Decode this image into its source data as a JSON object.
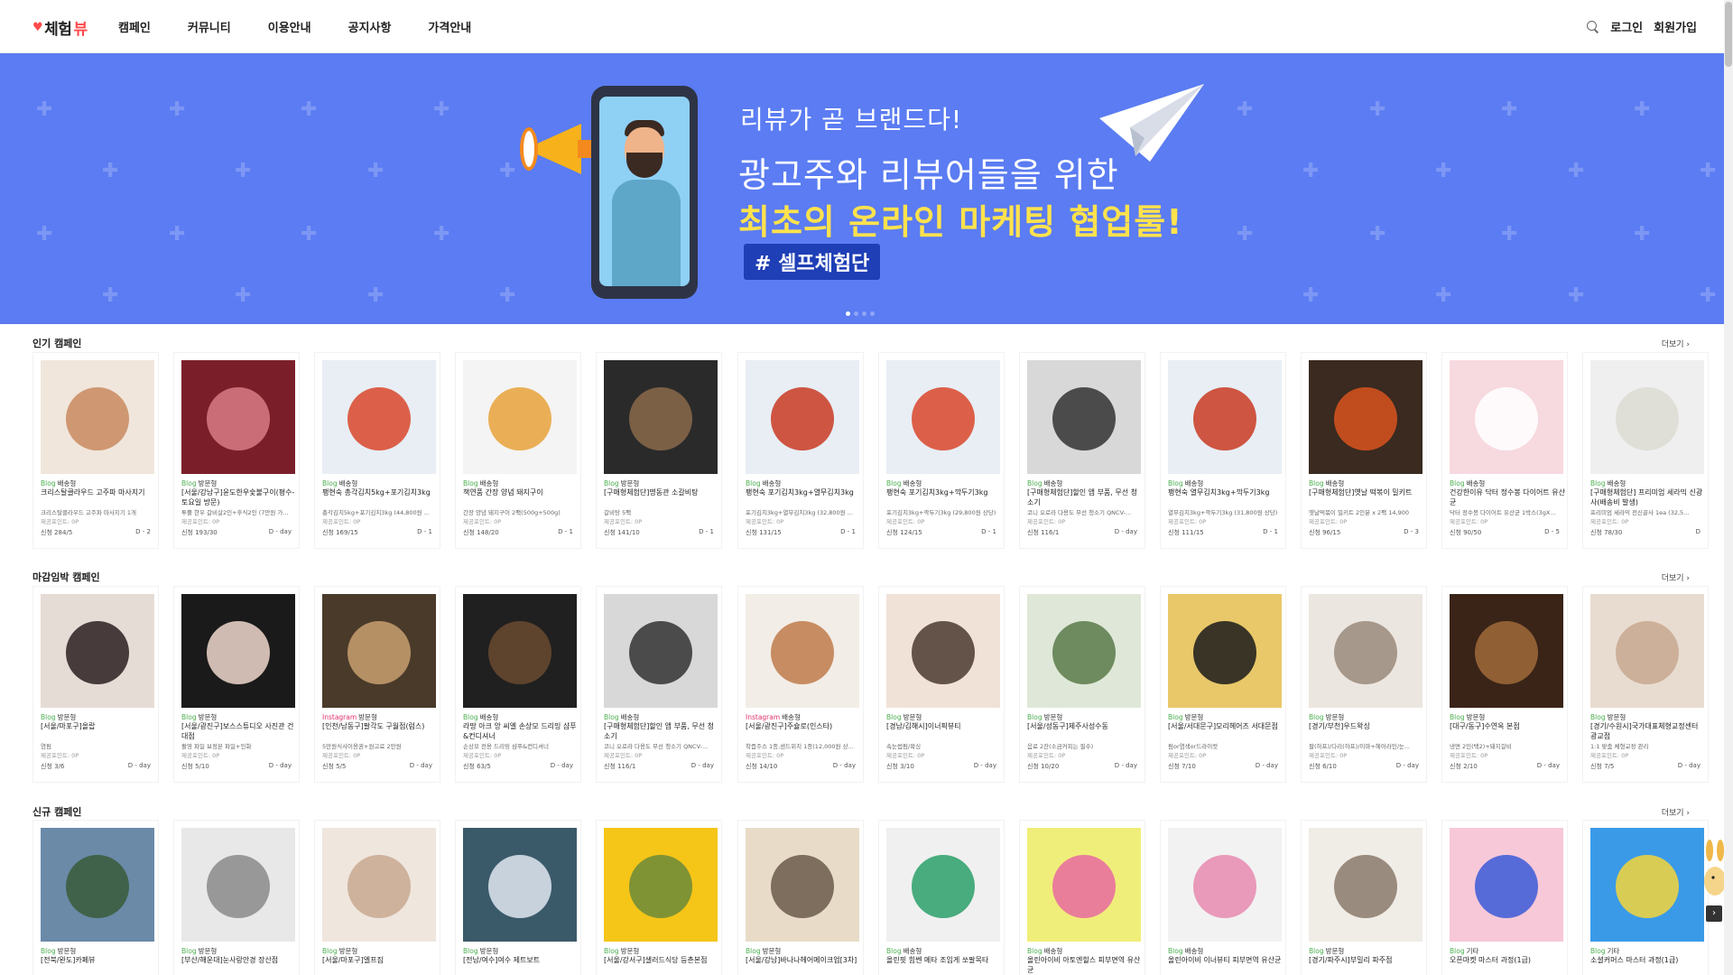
{
  "header": {
    "logo_text": "체험",
    "logo_accent": "뷰",
    "nav": [
      "캠페인",
      "커뮤니티",
      "이용안내",
      "공지사항",
      "가격안내"
    ],
    "login": "로그인",
    "signup": "회원가입"
  },
  "banner": {
    "line1": "리뷰가 곧 브랜드다!",
    "line2": "광고주와 리뷰어들을 위한",
    "line3": "최초의 온라인 마케팅 협업툴!",
    "tag": "# 셀프체험단"
  },
  "sections": [
    {
      "title": "인기 캠페인",
      "more": "더보기 ›",
      "cards": [
        {
          "platform": "Blog",
          "type": "배송형",
          "title": "크리스탈클라우드 고주파 마사지기",
          "desc": "크리스탈클라우드 고주파 마사지기 1개",
          "point": "제공포인트: 0P",
          "apply": "신청 284/5",
          "dday": "D - 2",
          "color": "#f0e6dc",
          "accent": "#c98a5f"
        },
        {
          "platform": "Blog",
          "type": "방문형",
          "title": "[서울/강남구]윤도한우숯불구이(평수-토요일 방문)",
          "desc": "투뿔 한우 갈비살2인+후식2인 (7만원 가...",
          "point": "제공포인트: 0P",
          "apply": "신청 193/30",
          "dday": "D - day",
          "color": "#7a1f2a",
          "accent": "#d97b84"
        },
        {
          "platform": "Blog",
          "type": "배송형",
          "title": "팽현숙 총각김치5kg+포기김치3kg",
          "desc": "총각김치5kg+포기김치3kg (44,800원 ...",
          "point": "제공포인트: 0P",
          "apply": "신청 169/15",
          "dday": "D - 1",
          "color": "#e8eef4",
          "accent": "#d9462a"
        },
        {
          "platform": "Blog",
          "type": "배송형",
          "title": "책연품 간장 양념 돼지구이",
          "desc": "간장 양념 돼지구이 2팩(500g+500g)",
          "point": "제공포인트: 0P",
          "apply": "신청 148/20",
          "dday": "D - 1",
          "color": "#f4f4f4",
          "accent": "#e8a23a"
        },
        {
          "platform": "Blog",
          "type": "방문형",
          "title": "[구매형체험단]명동관 소갈비탕",
          "desc": "갈비탕 5팩",
          "point": "제공포인트: 0P",
          "apply": "신청 141/10",
          "dday": "D - 1",
          "color": "#2a2a2a",
          "accent": "#8a6a4a"
        },
        {
          "platform": "Blog",
          "type": "배송형",
          "title": "팽현숙 포기김치3kg+열무김치3kg",
          "desc": "포기김치3kg+열무김치3kg (32,800원 ...",
          "point": "제공포인트: 0P",
          "apply": "신청 131/15",
          "dday": "D - 1",
          "color": "#e8eef4",
          "accent": "#c93a22"
        },
        {
          "platform": "Blog",
          "type": "배송형",
          "title": "팽현숙 포기김치3kg+깍두기3kg",
          "desc": "포기김치3kg+깍두기3kg (29,800원 상당)",
          "point": "제공포인트: 0P",
          "apply": "신청 124/15",
          "dday": "D - 1",
          "color": "#e8eef4",
          "accent": "#d9462a"
        },
        {
          "platform": "Blog",
          "type": "배송형",
          "title": "[구매형체험단]할인 앱 부품, 무선 청소기",
          "desc": "코니 오로라 다용도 무선 청소기 QNCV-...",
          "point": "제공포인트: 0P",
          "apply": "신청 116/1",
          "dday": "D - day",
          "color": "#d8d8d8",
          "accent": "#333333"
        },
        {
          "platform": "Blog",
          "type": "배송형",
          "title": "팽현숙 열무김치3kg+깍두기3kg",
          "desc": "열무김치3kg+깍두기3kg (31,800원 상당)",
          "point": "제공포인트: 0P",
          "apply": "신청 111/15",
          "dday": "D - 1",
          "color": "#e8eef4",
          "accent": "#c93a22"
        },
        {
          "platform": "Blog",
          "type": "배송형",
          "title": "[구매형체험단]옛날 떡볶이 밀키트",
          "desc": "옛날떡볶이 밀키트 2인분 x 2팩 14,900",
          "point": "제공포인트: 0P",
          "apply": "신청 96/15",
          "dday": "D - 3",
          "color": "#3a2a20",
          "accent": "#d9531e"
        },
        {
          "platform": "Blog",
          "type": "배송형",
          "title": "건강한이유 닥터 정수봉 다이어트 유산균",
          "desc": "닥터 정수봉 다이어트 유산균 1박스(3gX...",
          "point": "제공포인트: 0P",
          "apply": "신청 90/50",
          "dday": "D - 5",
          "color": "#f7d9e0",
          "accent": "#ffffff"
        },
        {
          "platform": "Blog",
          "type": "배송형",
          "title": "[구매형체험단] 프리미엄 세라믹 신광사(배송비 발생)",
          "desc": "프리미엄 세라믹 전신골사 1ea (32,5...",
          "point": "제공포인트: 0P",
          "apply": "신청 78/30",
          "dday": "D",
          "color": "#efefef",
          "accent": "#dcdcd2"
        }
      ]
    },
    {
      "title": "마감임박 캠페인",
      "more": "더보기 ›",
      "cards": [
        {
          "platform": "Blog",
          "type": "방문형",
          "title": "[서울/마포구]올랍",
          "desc": "염펌",
          "point": "제공포인트: 0P",
          "apply": "신청 3/6",
          "dday": "D - day",
          "color": "#e6dcd6",
          "accent": "#2a2020"
        },
        {
          "platform": "Blog",
          "type": "방문형",
          "title": "[서울/광진구]보스스튜디오 사진관 건대점",
          "desc": "촬영 파일 보정본 파일+인화",
          "point": "제공포인트: 0P",
          "apply": "신청 5/10",
          "dday": "D - day",
          "color": "#1a1a1a",
          "accent": "#f0d8cc"
        },
        {
          "platform": "Instagram",
          "type": "방문형",
          "title": "[인천/남동구]팔각도 구월점(럼스)",
          "desc": "5만원식사이용권+원고료 2만원",
          "point": "제공포인트: 0P",
          "apply": "신청 5/5",
          "dday": "D - day",
          "color": "#4a3a2a",
          "accent": "#c8a070"
        },
        {
          "platform": "Blog",
          "type": "배송형",
          "title": "라땅 아크 앙 씨엘 손상모 드리밍 샴푸&컨디셔너",
          "desc": "손상모 전용 드리밍 샴푸&컨디셔너",
          "point": "제공포인트: 0P",
          "apply": "신청 63/5",
          "dday": "D - day",
          "color": "#202020",
          "accent": "#6a4a30"
        },
        {
          "platform": "Blog",
          "type": "배송형",
          "title": "[구매형체험단]할인 앱 부품, 무선 청소기",
          "desc": "코니 오로라 다용도 무선 청소기 QNCV-...",
          "point": "제공포인트: 0P",
          "apply": "신청 116/1",
          "dday": "D - day",
          "color": "#d8d8d8",
          "accent": "#333333"
        },
        {
          "platform": "Instagram",
          "type": "배송형",
          "title": "[서울/광진구]주슐로(인스타)",
          "desc": "착즙주스 1종,샌드위치 1종(12,000원 상...",
          "point": "제공포인트: 0P",
          "apply": "신청 14/10",
          "dday": "D - day",
          "color": "#f2ede6",
          "accent": "#c07a4a"
        },
        {
          "platform": "Blog",
          "type": "방문형",
          "title": "[경남/김해시]이너픽뷰티",
          "desc": "속눈썹펌/왁싱",
          "point": "제공포인트: 0P",
          "apply": "신청 3/10",
          "dday": "D - day",
          "color": "#f1e2d8",
          "accent": "#4a3a30"
        },
        {
          "platform": "Blog",
          "type": "방문형",
          "title": "[서울/성동구]제주사성수동",
          "desc": "음료 2잔(소금커피는 필수)",
          "point": "제공포인트: 0P",
          "apply": "신청 10/20",
          "dday": "D - day",
          "color": "#dfe8d8",
          "accent": "#5a7a4a"
        },
        {
          "platform": "Blog",
          "type": "방문형",
          "title": "[서울/서대문구]모리헤어즈 서대문점",
          "desc": "펌or염색or드라이컷",
          "point": "제공포인트: 0P",
          "apply": "신청 7/10",
          "dday": "D - day",
          "color": "#e9c86a",
          "accent": "#1a1a1a"
        },
        {
          "platform": "Blog",
          "type": "방문형",
          "title": "[경기/부천]우드왁싱",
          "desc": "팔(하프)/다리(하프)/이마+헤어라인/눈...",
          "point": "제공포인트: 0P",
          "apply": "신청 6/10",
          "dday": "D - day",
          "color": "#ece6e0",
          "accent": "#9a8a7a"
        },
        {
          "platform": "Blog",
          "type": "방문형",
          "title": "[대구/동구]수연옥 본점",
          "desc": "냉면 2인(택2)+돼지갈비",
          "point": "제공포인트: 0P",
          "apply": "신청 2/10",
          "dday": "D - day",
          "color": "#3a2418",
          "accent": "#a06a3a"
        },
        {
          "platform": "Blog",
          "type": "방문형",
          "title": "[경기/수원시]국가대표체형교정센터 광교점",
          "desc": "1:1 맞춤 체형교정 관리",
          "point": "제공포인트: 0P",
          "apply": "신청 7/5",
          "dday": "D - day",
          "color": "#e8dcd0",
          "accent": "#c8a890"
        }
      ]
    },
    {
      "title": "신규 캠페인",
      "more": "더보기 ›",
      "cards": [
        {
          "platform": "Blog",
          "type": "방문형",
          "title": "[전북/완도]카페뷰",
          "color": "#6a8aa8",
          "accent": "#3a5a3a"
        },
        {
          "platform": "Blog",
          "type": "방문형",
          "title": "[부산/해운대]눈사랑안경 장산점",
          "color": "#e8e8e8",
          "accent": "#8a8a8a"
        },
        {
          "platform": "Blog",
          "type": "방문형",
          "title": "[서울/마포구]엘프짐",
          "color": "#efe6de",
          "accent": "#c8a890"
        },
        {
          "platform": "Blog",
          "type": "방문형",
          "title": "[전남/여수]여수 제트보트",
          "color": "#3a5a6a",
          "accent": "#e0e8f0"
        },
        {
          "platform": "Blog",
          "type": "방문형",
          "title": "[서울/강서구]샐러드식당 등촌본점",
          "color": "#f5c518",
          "accent": "#6a8a3a"
        },
        {
          "platform": "Blog",
          "type": "방문형",
          "title": "[서울/강남]바나나헤어메이크업[3차]",
          "color": "#e8dcc8",
          "accent": "#6a5a4a"
        },
        {
          "platform": "Blog",
          "type": "배송형",
          "title": "올린핏 힘쎈 메타 조임게 쏘팔목타",
          "color": "#f0f0f0",
          "accent": "#2aa06a"
        },
        {
          "platform": "Blog",
          "type": "배송형",
          "title": "올린아이비 아토엔힐스 피부면역 유산균",
          "color": "#f0ee7a",
          "accent": "#e86aa0"
        },
        {
          "platform": "Blog",
          "type": "배송형",
          "title": "올린아이비 이너뷰티 피부면역 유산균",
          "color": "#f2f2f2",
          "accent": "#e88ab0"
        },
        {
          "platform": "Blog",
          "type": "방문형",
          "title": "[경기/파주시]부밀리 파주점",
          "color": "#f0ece6",
          "accent": "#8a7a6a"
        },
        {
          "platform": "Blog",
          "type": "기타",
          "title": "오픈마켓 마스터 과정(1급)",
          "color": "#f7c8d8",
          "accent": "#3a5ad8"
        },
        {
          "platform": "Blog",
          "type": "기타",
          "title": "소셜커머스 마스터 과정(1급)",
          "color": "#3a9ae8",
          "accent": "#f5d53a"
        }
      ]
    }
  ]
}
